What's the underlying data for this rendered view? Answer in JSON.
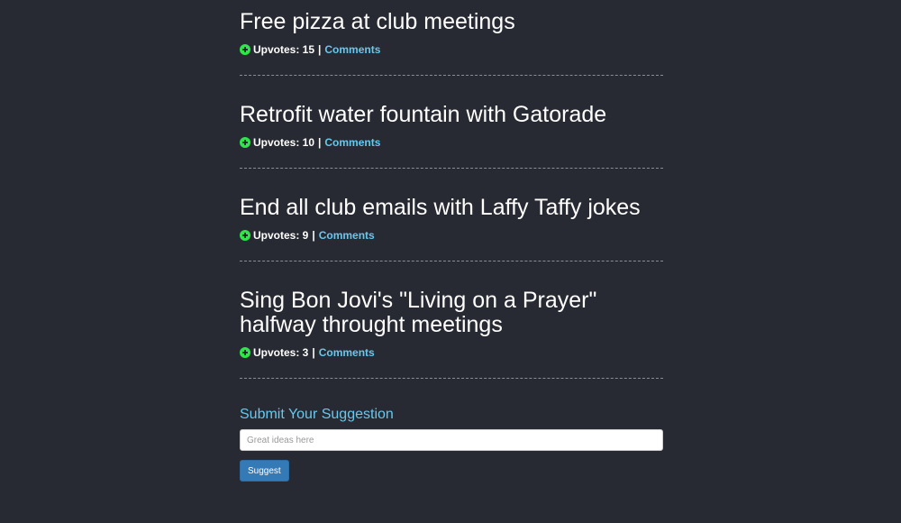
{
  "suggestions": [
    {
      "title": "Free pizza at club meetings",
      "upvotes_label": "Upvotes: 15",
      "separator": "|",
      "comments_label": "Comments"
    },
    {
      "title": "Retrofit water fountain with Gatorade",
      "upvotes_label": "Upvotes: 10",
      "separator": "|",
      "comments_label": "Comments"
    },
    {
      "title": "End all club emails with Laffy Taffy jokes",
      "upvotes_label": "Upvotes: 9",
      "separator": "|",
      "comments_label": "Comments"
    },
    {
      "title": "Sing Bon Jovi's \"Living on a Prayer\" halfway throught meetings",
      "upvotes_label": "Upvotes: 3",
      "separator": "|",
      "comments_label": "Comments"
    }
  ],
  "form": {
    "title": "Submit Your Suggestion",
    "input_value": "",
    "input_placeholder": "Great ideas here",
    "button_label": "Suggest"
  },
  "icons": {
    "upvote": "plus-circle-icon"
  },
  "colors": {
    "background": "#272a32",
    "upvote_icon": "#2ee64a",
    "link": "#66c8ee",
    "button": "#337ab7"
  }
}
